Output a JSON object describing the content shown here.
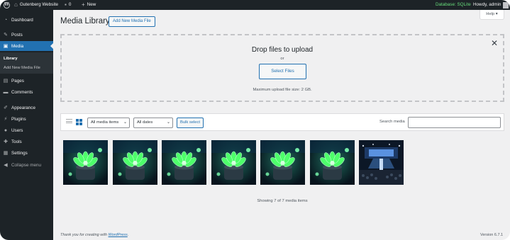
{
  "admin_bar": {
    "site_name": "Gutenberg Website",
    "comments_count": "0",
    "new_label": "New",
    "database_label": "Database: SQLite",
    "greeting": "Howdy, admin",
    "icons": {
      "logo": "wordpress-logo-icon",
      "home": "home-icon",
      "comments": "comment-bubble-icon",
      "plus": "plus-icon",
      "avatar": "avatar-icon"
    }
  },
  "sidebar": {
    "items": [
      {
        "label": "Dashboard",
        "icon": "dashboard-icon"
      },
      {
        "label": "Posts",
        "icon": "pin-icon"
      },
      {
        "label": "Media",
        "icon": "media-icon"
      },
      {
        "label": "Pages",
        "icon": "pages-icon"
      },
      {
        "label": "Comments",
        "icon": "comments-icon"
      },
      {
        "label": "Appearance",
        "icon": "paintbrush-icon"
      },
      {
        "label": "Plugins",
        "icon": "plug-icon"
      },
      {
        "label": "Users",
        "icon": "users-icon"
      },
      {
        "label": "Tools",
        "icon": "wrench-icon"
      },
      {
        "label": "Settings",
        "icon": "settings-icon"
      }
    ],
    "submenu": [
      "Library",
      "Add New Media File"
    ],
    "collapse_label": "Collapse menu",
    "current": "Media"
  },
  "header": {
    "title": "Media Library",
    "add_new_label": "Add New Media File",
    "help_label": "Help ▾"
  },
  "uploader": {
    "title": "Drop files to upload",
    "or_text": "or",
    "select_files_label": "Select Files",
    "max_size_text": "Maximum upload file size: 2 GB.",
    "close_symbol": "✕"
  },
  "toolbar": {
    "type_filter": "All media items",
    "date_filter": "All dates",
    "bulk_select_label": "Bulk select",
    "search_label": "Search media",
    "search_value": ""
  },
  "media_items": [
    {
      "kind": "succulent"
    },
    {
      "kind": "succulent"
    },
    {
      "kind": "succulent"
    },
    {
      "kind": "succulent"
    },
    {
      "kind": "succulent"
    },
    {
      "kind": "succulent"
    },
    {
      "kind": "stage"
    }
  ],
  "status": {
    "showing_text": "Showing 7 of 7 media items"
  },
  "footer": {
    "thanks_prefix": "Thank you for creating with ",
    "wordpress_link": "WordPress",
    "thanks_suffix": ".",
    "version": "Version 6.7.1"
  },
  "colors": {
    "admin_dark": "#1d2327",
    "accent_blue": "#2271b1",
    "background": "#f0f0f1",
    "sqlite_green": "#68de7c"
  }
}
